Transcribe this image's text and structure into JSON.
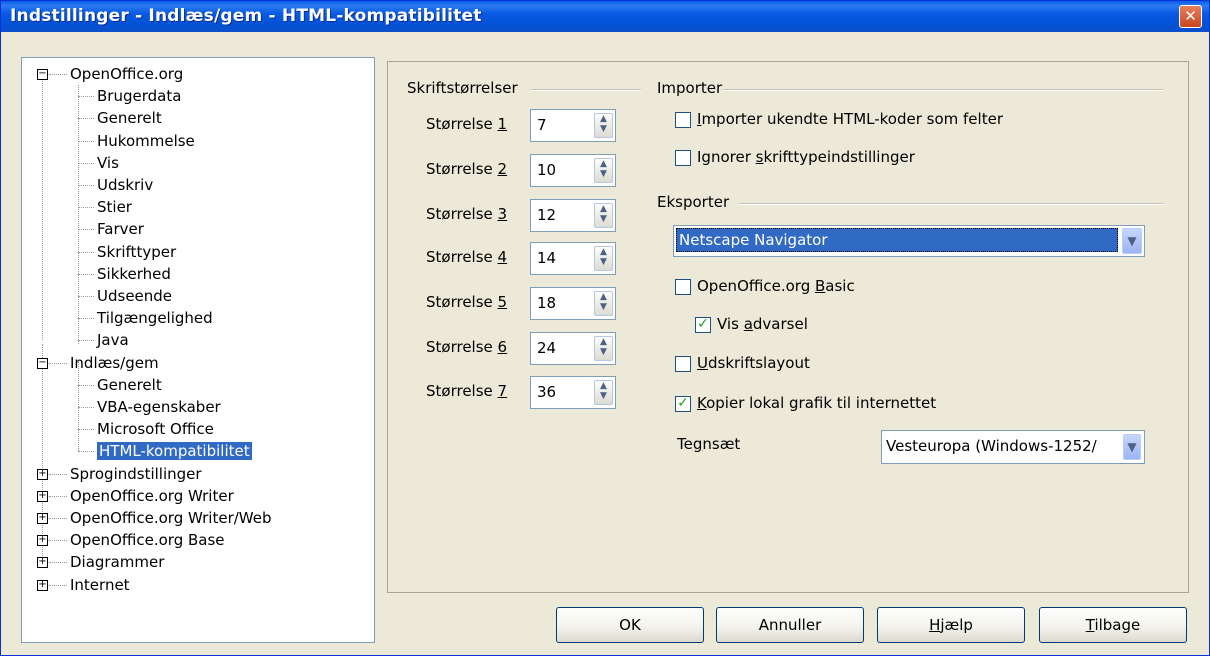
{
  "window": {
    "title": "Indstillinger - Indlæs/gem - HTML-kompatibilitet",
    "close_label": "✕"
  },
  "tree": {
    "items": [
      {
        "label": "OpenOffice.org",
        "expander": "⊟"
      },
      {
        "label": "Brugerdata"
      },
      {
        "label": "Generelt"
      },
      {
        "label": "Hukommelse"
      },
      {
        "label": "Vis"
      },
      {
        "label": "Udskriv"
      },
      {
        "label": "Stier"
      },
      {
        "label": "Farver"
      },
      {
        "label": "Skrifttyper"
      },
      {
        "label": "Sikkerhed"
      },
      {
        "label": "Udseende"
      },
      {
        "label": "Tilgængelighed"
      },
      {
        "label": "Java"
      },
      {
        "label": "Indlæs/gem",
        "expander": "⊟"
      },
      {
        "label": "Generelt"
      },
      {
        "label": "VBA-egenskaber"
      },
      {
        "label": "Microsoft Office"
      },
      {
        "label": "HTML-kompatibilitet",
        "selected": true
      },
      {
        "label": "Sprogindstillinger",
        "expander": "⊞"
      },
      {
        "label": "OpenOffice.org Writer",
        "expander": "⊞"
      },
      {
        "label": "OpenOffice.org Writer/Web",
        "expander": "⊞"
      },
      {
        "label": "OpenOffice.org Base",
        "expander": "⊞"
      },
      {
        "label": "Diagrammer",
        "expander": "⊞"
      },
      {
        "label": "Internet",
        "expander": "⊞"
      }
    ]
  },
  "font_sizes": {
    "heading": "Skriftstørrelser",
    "rows": [
      {
        "label": "Størrelse ",
        "key": "1",
        "value": "7"
      },
      {
        "label": "Størrelse ",
        "key": "2",
        "value": "10"
      },
      {
        "label": "Størrelse ",
        "key": "3",
        "value": "12"
      },
      {
        "label": "Størrelse ",
        "key": "4",
        "value": "14"
      },
      {
        "label": "Størrelse ",
        "key": "5",
        "value": "18"
      },
      {
        "label": "Størrelse ",
        "key": "6",
        "value": "24"
      },
      {
        "label": "Størrelse ",
        "key": "7",
        "value": "36"
      }
    ]
  },
  "import": {
    "heading": "Importer",
    "unknown_tags": {
      "key": "I",
      "rest": "mporter ukendte HTML-koder som felter",
      "checked": false
    },
    "ignore_fonts": {
      "pre": "Ignorer ",
      "key": "s",
      "rest": "krifttypeindstillinger",
      "checked": false
    }
  },
  "export": {
    "heading": "Eksporter",
    "browser_value": "Netscape Navigator",
    "basic": {
      "pre": "OpenOffice.org ",
      "key": "B",
      "rest": "asic",
      "checked": false
    },
    "warning": {
      "pre": "Vis ",
      "key": "a",
      "rest": "dvarsel",
      "checked": true
    },
    "print_layout": {
      "key": "U",
      "rest": "dskriftslayout",
      "checked": false
    },
    "copy_graphics": {
      "key": "K",
      "rest": "opier lokal grafik til internettet",
      "checked": true
    },
    "charset_label_pre": "Te",
    "charset_label_key": "g",
    "charset_label_rest": "nsæt",
    "charset_value": "Vesteuropa (Windows-1252/"
  },
  "buttons": {
    "ok": "OK",
    "cancel": "Annuller",
    "help_key": "H",
    "help_rest": "jælp",
    "reset_key": "T",
    "reset_rest": "ilbage"
  },
  "colors": {
    "title_bar": "#0a5ee8",
    "selection": "#316ac5",
    "check": "#21a121"
  }
}
